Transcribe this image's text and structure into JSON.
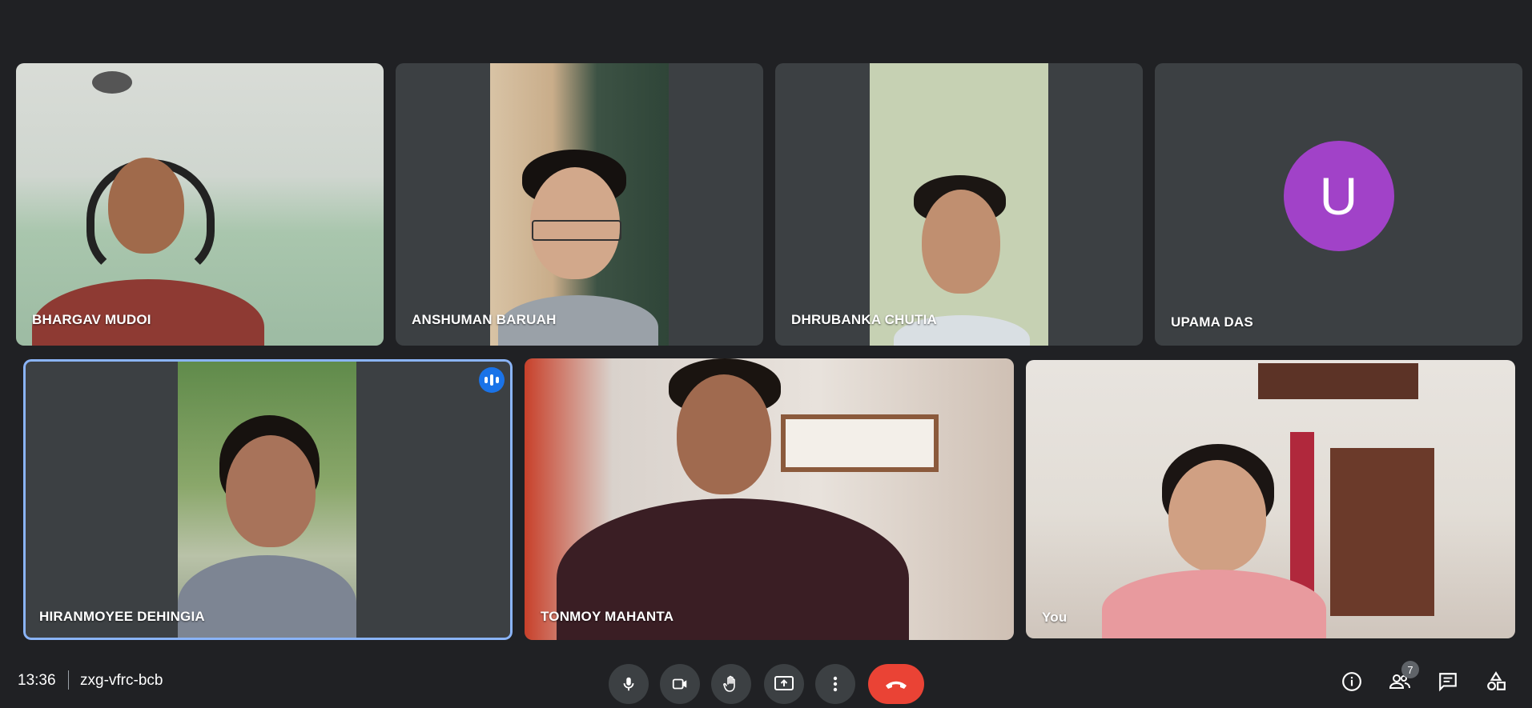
{
  "participants": [
    {
      "name": "BHARGAV MUDOI"
    },
    {
      "name": "ANSHUMAN BARUAH"
    },
    {
      "name": "DHRUBANKA CHUTIA"
    },
    {
      "name": "UPAMA DAS",
      "avatar_initial": "U",
      "avatar_color": "#a142c8"
    },
    {
      "name": "HIRANMOYEE DEHINGIA",
      "speaking": true
    },
    {
      "name": "TONMOY MAHANTA"
    },
    {
      "name": "You"
    }
  ],
  "bottom_bar": {
    "time": "13:36",
    "meeting_code": "zxg-vfrc-bcb",
    "participant_count": "7",
    "controls": [
      "microphone-icon",
      "camera-icon",
      "raise-hand-icon",
      "present-screen-icon",
      "more-options-icon",
      "end-call-icon"
    ],
    "right_icons": [
      "info-icon",
      "people-icon",
      "chat-icon",
      "activities-icon"
    ]
  },
  "colors": {
    "background": "#202124",
    "tile": "#3c4043",
    "end_call": "#ea4335",
    "active_speaker_border": "#8ab4f8",
    "speaking_indicator": "#1a73e8"
  }
}
